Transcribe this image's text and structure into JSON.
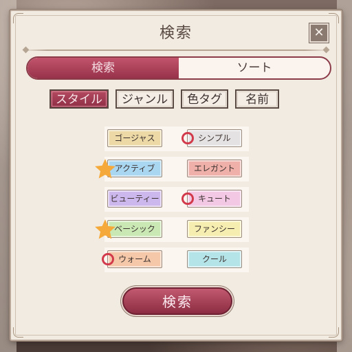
{
  "dialog": {
    "title": "検索",
    "close_label": "✕"
  },
  "main_tabs": [
    {
      "label": "検索",
      "active": true
    },
    {
      "label": "ソート",
      "active": false
    }
  ],
  "category_tabs": [
    {
      "label": "スタイル",
      "active": true
    },
    {
      "label": "ジャンル",
      "active": false
    },
    {
      "label": "色タグ",
      "active": false
    },
    {
      "label": "名前",
      "active": false
    }
  ],
  "style_options": [
    [
      {
        "label": "ゴージャス",
        "color": "#ecd9a6",
        "mark": "none"
      },
      {
        "label": "シンプル",
        "color": "#e4e2e2",
        "mark": "circle"
      }
    ],
    [
      {
        "label": "アクティブ",
        "color": "#a9d6f0",
        "mark": "star"
      },
      {
        "label": "エレガント",
        "color": "#eeb0a8",
        "mark": "none"
      }
    ],
    [
      {
        "label": "ビューティー",
        "color": "#cdb8ee",
        "mark": "none"
      },
      {
        "label": "キュート",
        "color": "#f2c8e4",
        "mark": "circle"
      }
    ],
    [
      {
        "label": "ベーシック",
        "color": "#c9e8b4",
        "mark": "star"
      },
      {
        "label": "ファンシー",
        "color": "#f5eeb0",
        "mark": "none"
      }
    ],
    [
      {
        "label": "ウォーム",
        "color": "#f4c8a8",
        "mark": "circle"
      },
      {
        "label": "クール",
        "color": "#b4e4e8",
        "mark": "none"
      }
    ]
  ],
  "search_button": {
    "label": "検索"
  },
  "colors": {
    "accent": "#9c3a50",
    "circle_mark": "#d23a4b",
    "star_mark": "#f5a93a"
  }
}
